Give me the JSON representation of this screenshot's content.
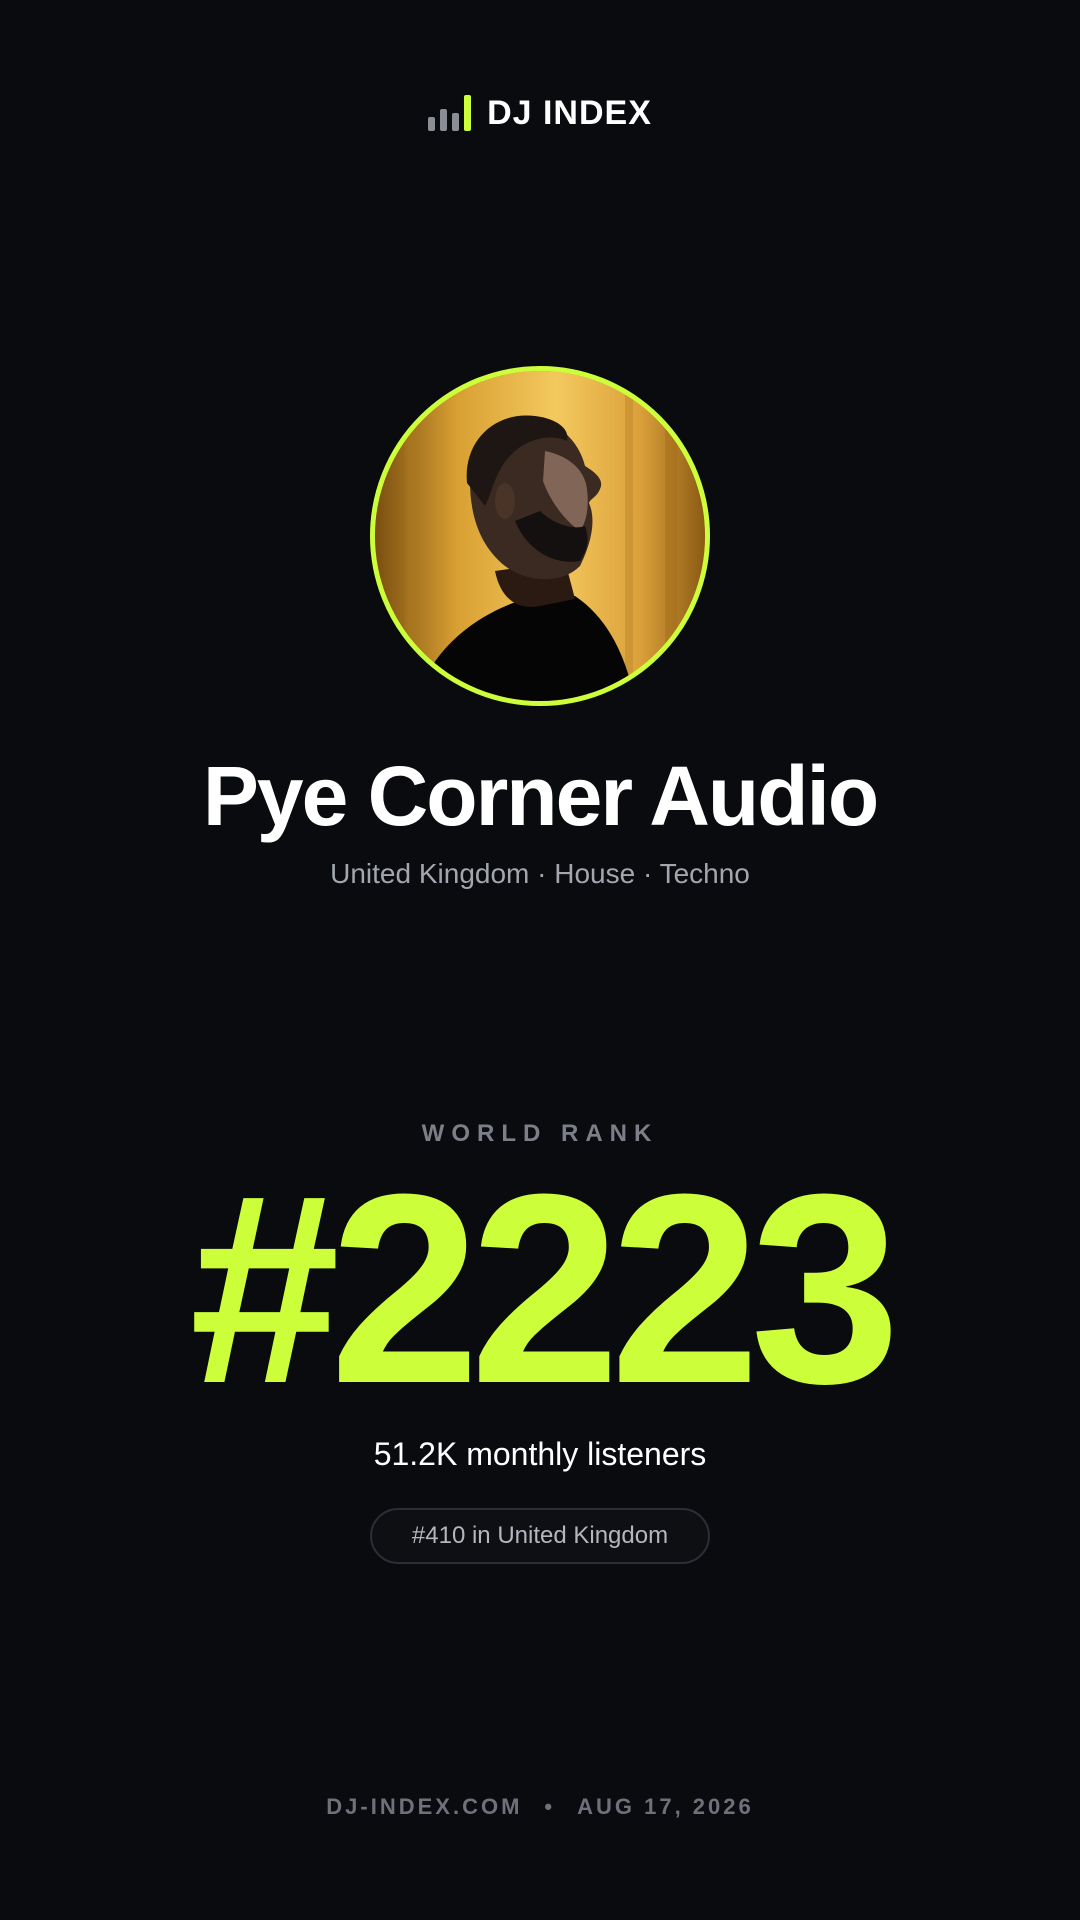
{
  "brand": {
    "name": "DJ INDEX",
    "icon": "bar-chart-icon",
    "accent_color": "#ccff3a"
  },
  "artist": {
    "name": "Pye Corner Audio",
    "meta": "United Kingdom · House · Techno",
    "photo": "artist-portrait-image"
  },
  "rank": {
    "label": "WORLD RANK",
    "value": "#2223",
    "listeners": "51.2K monthly listeners",
    "country_rank": "#410 in United Kingdom"
  },
  "footer": {
    "site": "DJ-INDEX.COM",
    "separator": "•",
    "date": "AUG 17, 2026"
  },
  "colors": {
    "background": "#0a0b0e",
    "accent": "#ccff3a",
    "muted_text": "#a3a6ae"
  }
}
